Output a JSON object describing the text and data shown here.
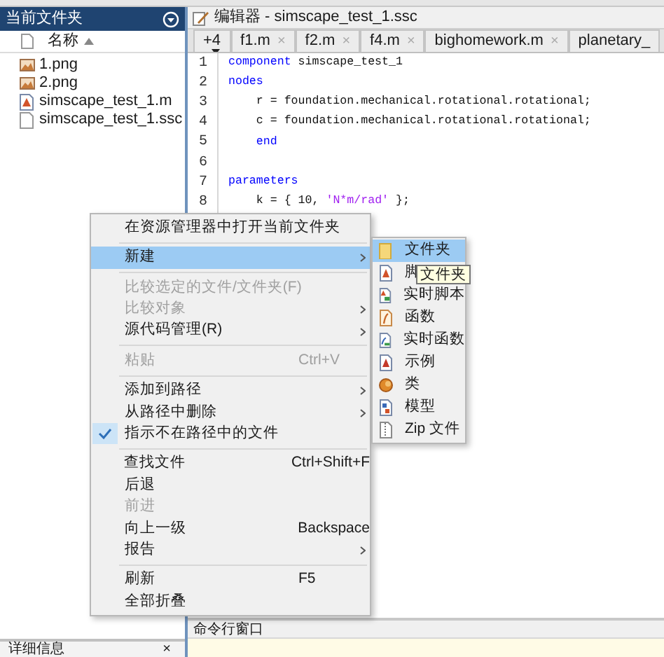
{
  "file_panel": {
    "title": "当前文件夹",
    "column": "名称",
    "files": [
      {
        "name": "1.png",
        "kind": "image"
      },
      {
        "name": "2.png",
        "kind": "image"
      },
      {
        "name": "simscape_test_1.m",
        "kind": "script"
      },
      {
        "name": "simscape_test_1.ssc",
        "kind": "document"
      }
    ],
    "details": {
      "title": "详细信息",
      "close": "×"
    }
  },
  "editor": {
    "title": "编辑器 - simscape_test_1.ssc",
    "tabs": [
      {
        "label": "+4",
        "kind": "overflow"
      },
      {
        "label": "f1.m",
        "close": "×"
      },
      {
        "label": "f2.m",
        "close": "×"
      },
      {
        "label": "f4.m",
        "close": "×"
      },
      {
        "label": "bighomework.m",
        "close": "×"
      },
      {
        "label": "planetary_"
      }
    ],
    "lines": [
      {
        "number": "1",
        "tokens": [
          {
            "text": "component",
            "kind": "keyword"
          },
          {
            "text": " simscape_test_1",
            "kind": "plain"
          }
        ]
      },
      {
        "number": "2",
        "tokens": [
          {
            "text": "nodes",
            "kind": "keyword"
          }
        ]
      },
      {
        "number": "3",
        "tokens": [
          {
            "text": "    r = foundation.mechanical.rotational.rotational;",
            "kind": "plain"
          }
        ]
      },
      {
        "number": "4",
        "tokens": [
          {
            "text": "    c = foundation.mechanical.rotational.rotational;",
            "kind": "plain"
          }
        ]
      },
      {
        "number": "5",
        "tokens": [
          {
            "text": "    end",
            "kind": "keyword"
          }
        ]
      },
      {
        "number": "6"
      },
      {
        "number": "7",
        "tokens": [
          {
            "text": "parameters",
            "kind": "keyword"
          }
        ]
      },
      {
        "number": "8",
        "tokens": [
          {
            "text": "    k = { 10, ",
            "kind": "plain"
          },
          {
            "text": "'N*m/rad'",
            "kind": "string"
          },
          {
            "text": " };",
            "kind": "plain"
          }
        ]
      }
    ]
  },
  "command_window": {
    "title": "命令行窗口"
  },
  "context_menu": {
    "groups": [
      [
        {
          "label": "在资源管理器中打开当前文件夹",
          "disabled": false,
          "checked": false,
          "selected": false,
          "has_submenu": false
        }
      ],
      [
        {
          "label": "新建",
          "disabled": false,
          "checked": false,
          "selected": true,
          "has_submenu": true
        }
      ],
      [
        {
          "label": "比较选定的文件/文件夹(F)",
          "disabled": true,
          "checked": false,
          "selected": false,
          "has_submenu": false
        },
        {
          "label": "比较对象",
          "disabled": true,
          "checked": false,
          "selected": false,
          "has_submenu": true
        },
        {
          "label": "源代码管理(R)",
          "disabled": false,
          "checked": false,
          "selected": false,
          "has_submenu": true
        }
      ],
      [
        {
          "label": "粘贴",
          "shortcut": "Ctrl+V",
          "disabled": true,
          "checked": false,
          "selected": false,
          "has_submenu": false
        }
      ],
      [
        {
          "label": "添加到路径",
          "disabled": false,
          "checked": false,
          "selected": false,
          "has_submenu": true
        },
        {
          "label": "从路径中删除",
          "disabled": false,
          "checked": false,
          "selected": false,
          "has_submenu": true
        },
        {
          "label": "指示不在路径中的文件",
          "disabled": false,
          "checked": true,
          "selected": false,
          "has_submenu": false
        }
      ],
      [
        {
          "label": "查找文件",
          "shortcut": "Ctrl+Shift+F",
          "disabled": false,
          "checked": false,
          "selected": false,
          "has_submenu": false
        },
        {
          "label": "后退",
          "disabled": false,
          "checked": false,
          "selected": false,
          "has_submenu": false
        },
        {
          "label": "前进",
          "disabled": true,
          "checked": false,
          "selected": false,
          "has_submenu": false
        },
        {
          "label": "向上一级",
          "shortcut": "Backspace",
          "disabled": false,
          "checked": false,
          "selected": false,
          "has_submenu": false
        },
        {
          "label": "报告",
          "disabled": false,
          "checked": false,
          "selected": false,
          "has_submenu": true
        }
      ],
      [
        {
          "label": "刷新",
          "shortcut": "F5",
          "disabled": false,
          "checked": false,
          "selected": false,
          "has_submenu": false
        },
        {
          "label": "全部折叠",
          "disabled": false,
          "checked": false,
          "selected": false,
          "has_submenu": false
        }
      ]
    ]
  },
  "new_submenu": {
    "items": [
      {
        "label": "文件夹",
        "kind": "folder",
        "selected": true
      },
      {
        "label": "脚",
        "kind": "script",
        "selected": false
      },
      {
        "label": "实时脚本",
        "kind": "live-script",
        "selected": false
      },
      {
        "label": "函数",
        "kind": "function",
        "selected": false
      },
      {
        "label": "实时函数",
        "kind": "live-function",
        "selected": false
      },
      {
        "label": "示例",
        "kind": "example",
        "selected": false
      },
      {
        "label": "类",
        "kind": "class",
        "selected": false
      },
      {
        "label": "模型",
        "kind": "model",
        "selected": false
      },
      {
        "label": "Zip 文件",
        "kind": "zip",
        "selected": false
      }
    ],
    "tooltip": "文件夹"
  }
}
